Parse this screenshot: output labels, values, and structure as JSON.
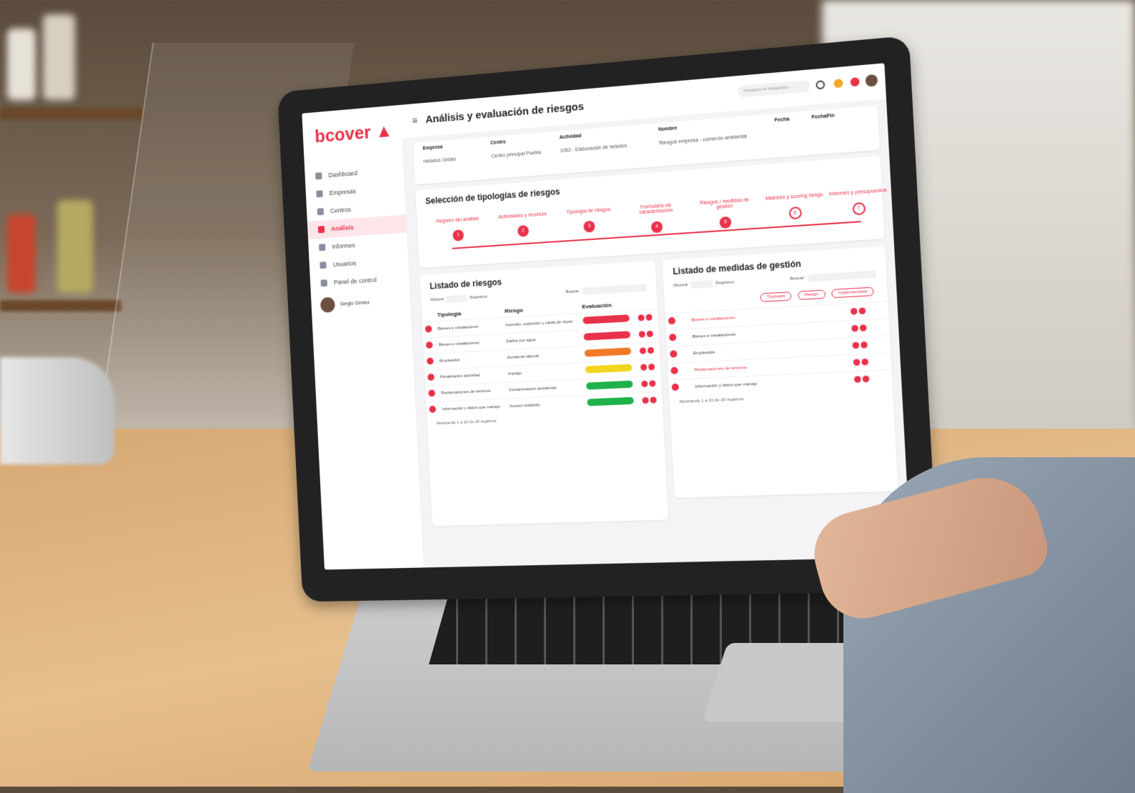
{
  "app": {
    "logo": "bcover",
    "page_title": "Análisis y evaluación de riesgos"
  },
  "sidebar": {
    "items": [
      {
        "label": "Dashboard"
      },
      {
        "label": "Empresas"
      },
      {
        "label": "Centros"
      },
      {
        "label": "Análisis",
        "active": true
      },
      {
        "label": "Informes"
      },
      {
        "label": "Usuarios"
      },
      {
        "label": "Panel de control"
      }
    ],
    "user_name": "Sergio Gómez"
  },
  "header": {
    "search_placeholder": "Introduce tu búsqueda..."
  },
  "info": {
    "headers": [
      "Empresa",
      "Centro",
      "Actividad",
      "Nombre",
      "Fecha",
      "FechaFin"
    ],
    "row": [
      "Helados Gelato",
      "Centro principal Puebla",
      "1052 - Elaboración de helados",
      "Riesgos empresa - comercio ambiental",
      "",
      ""
    ]
  },
  "stepper": {
    "title": "Selección de tipologías de riesgos",
    "steps": [
      {
        "label": "Registro del análisis",
        "num": "1",
        "done": true
      },
      {
        "label": "Actividades y recursos",
        "num": "2",
        "done": true
      },
      {
        "label": "Tipología de riesgos",
        "num": "3",
        "done": true
      },
      {
        "label": "Formulario de caracterización",
        "num": "4",
        "done": true
      },
      {
        "label": "Riesgos / medidas de gestión",
        "num": "5",
        "done": true
      },
      {
        "label": "Matrices y scoring riesgo",
        "num": "6",
        "done": false
      },
      {
        "label": "Informes y presupuestos",
        "num": "7",
        "done": false
      }
    ]
  },
  "riesgos": {
    "title": "Listado de riesgos",
    "mostrar": "Mostrar",
    "registros": "Registros",
    "buscar": "Buscar:",
    "columns": [
      "Tipología",
      "Riesgo",
      "Evaluación"
    ],
    "rows": [
      {
        "tipologia": "Bienes e instalaciones",
        "riesgo": "Incendio, explosión y caída de rayos",
        "color": "#e8324a"
      },
      {
        "tipologia": "Bienes e instalaciones",
        "riesgo": "Daños por agua",
        "color": "#e8324a"
      },
      {
        "tipologia": "Empleados",
        "riesgo": "Accidente laboral",
        "color": "#f07a2a"
      },
      {
        "tipologia": "Paralización actividad",
        "riesgo": "Impago",
        "color": "#f2d51c"
      },
      {
        "tipologia": "Reclamaciones de terceros",
        "riesgo": "Contaminación accidental",
        "color": "#1fb24a"
      },
      {
        "tipologia": "Información y datos que manejo",
        "riesgo": "Acceso indebido",
        "color": "#1fb24a"
      }
    ],
    "footer": "Mostrando 1 a 10 de 20 registros"
  },
  "medidas": {
    "title": "Listado de medidas de gestión",
    "mostrar": "Mostrar",
    "registros": "Registros",
    "buscar": "Buscar:",
    "filters": [
      "Tipología",
      "Riesgo",
      "Implementada"
    ],
    "rows": [
      {
        "tipologia": "Bienes e instalaciones",
        "red": true
      },
      {
        "tipologia": "Bienes e instalaciones",
        "red": false
      },
      {
        "tipologia": "Empleados",
        "red": false
      },
      {
        "tipologia": "Reclamaciones de terceros",
        "red": true
      },
      {
        "tipologia": "Información y datos que manejo",
        "red": false
      }
    ],
    "footer": "Mostrando 1 a 10 de 20 registros"
  }
}
